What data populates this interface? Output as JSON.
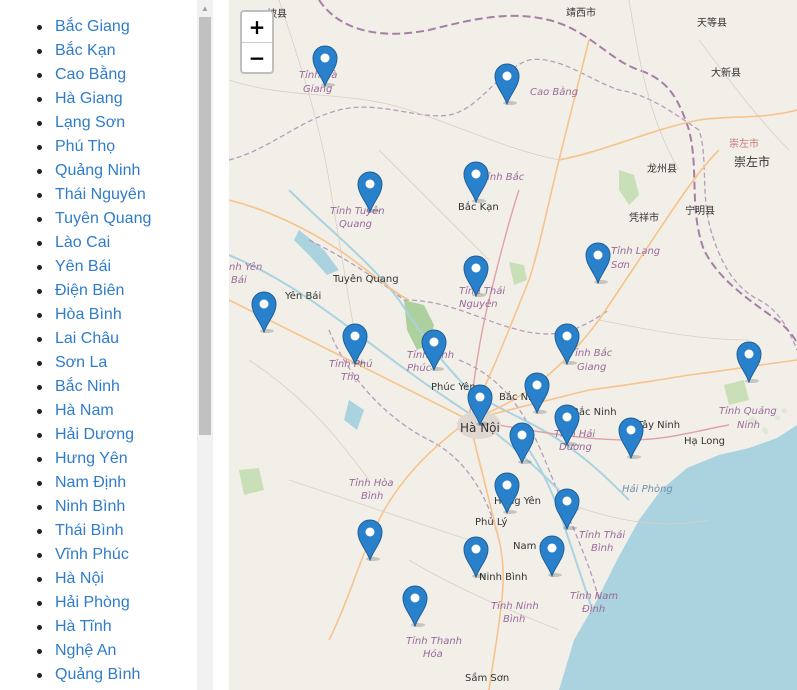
{
  "provinces": [
    "Bắc Giang",
    "Bắc Kạn",
    "Cao Bằng",
    "Hà Giang",
    "Lạng Sơn",
    "Phú Thọ",
    "Quảng Ninh",
    "Thái Nguyên",
    "Tuyên Quang",
    "Lào Cai",
    "Yên Bái",
    "Điện Biên",
    "Hòa Bình",
    "Lai Châu",
    "Sơn La",
    "Bắc Ninh",
    "Hà Nam",
    "Hải Dương",
    "Hưng Yên",
    "Nam Định",
    "Ninh Bình",
    "Thái Bình",
    "Vĩnh Phúc",
    "Hà Nội",
    "Hải Phòng",
    "Hà Tĩnh",
    "Nghệ An",
    "Quảng Bình"
  ],
  "map": {
    "zoom_in_label": "+",
    "zoom_out_label": "−",
    "marker_color": "#2a81cb",
    "water_color": "#aad3df",
    "land_color": "#f2efe9",
    "forest_color": "#add19e",
    "labels": [
      "Tỉnh Hà Giang",
      "Cao Bằng",
      "Tỉnh Bắc Kạn",
      "Bắc Kạn",
      "Tỉnh Tuyên Quang",
      "Tỉnh Lạng Sơn",
      "Tuyên Quang",
      "Tỉnh Yên Bái",
      "Yên Bái",
      "Tỉnh Thái Nguyên",
      "Tỉnh Vĩnh Phúc",
      "Phúc Yên",
      "Tỉnh Phú Thọ",
      "Tỉnh Bắc Giang",
      "Bắc Ninh",
      "Bắc Ninh",
      "Hà Nội",
      "Tỉnh Hải Dương",
      "Hạ Long",
      "Tỉnh Quảng Ninh",
      "Tỉnh Hòa Bình",
      "Hưng Yên",
      "Hải Phòng",
      "Phủ Lý",
      "Nam Định",
      "Tỉnh Thái Bình",
      "Ninh Bình",
      "Tỉnh Ninh Bình",
      "Tỉnh Nam Định",
      "Tỉnh Thanh Hóa",
      "Sầm Sơn",
      "Bắc Ninh",
      "Tây Ninh"
    ],
    "cn_labels": [
      "靖西市",
      "天等县",
      "大新县",
      "崇左市",
      "崇左市",
      "龙州县",
      "宁明县",
      "凭祥市",
      "坡县"
    ],
    "markers": [
      "marker-ha-giang",
      "marker-cao-bang",
      "marker-bac-kan",
      "marker-tuyen-quang",
      "marker-lang-son",
      "marker-yen-bai",
      "marker-thai-nguyen",
      "marker-phu-tho",
      "marker-vinh-phuc",
      "marker-bac-giang",
      "marker-quang-ninh",
      "marker-bac-ninh",
      "marker-ha-noi",
      "marker-hai-duong",
      "marker-hai-phong",
      "marker-hung-yen",
      "marker-hoa-binh",
      "marker-thai-binh",
      "marker-ha-nam",
      "marker-nam-dinh",
      "marker-ninh-binh",
      "marker-thanh-hoa"
    ]
  }
}
